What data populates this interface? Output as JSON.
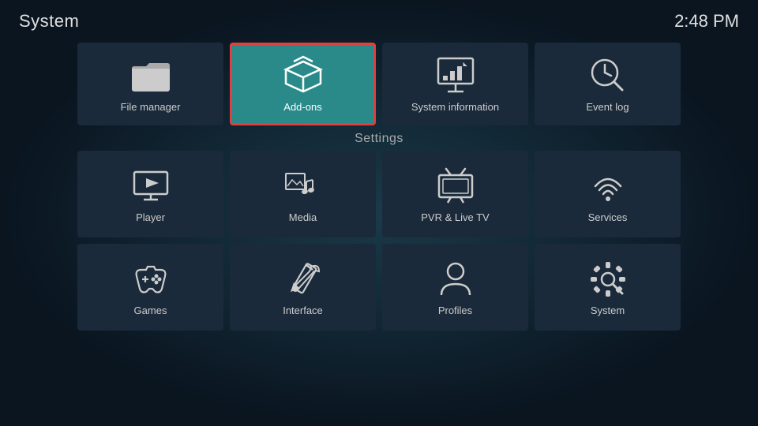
{
  "header": {
    "title": "System",
    "time": "2:48 PM"
  },
  "section_label": "Settings",
  "top_row": [
    {
      "id": "file-manager",
      "label": "File manager",
      "icon": "folder"
    },
    {
      "id": "add-ons",
      "label": "Add-ons",
      "icon": "box",
      "selected": true
    },
    {
      "id": "system-information",
      "label": "System information",
      "icon": "presentation"
    },
    {
      "id": "event-log",
      "label": "Event log",
      "icon": "clock-search"
    }
  ],
  "settings_row1": [
    {
      "id": "player",
      "label": "Player",
      "icon": "play"
    },
    {
      "id": "media",
      "label": "Media",
      "icon": "media"
    },
    {
      "id": "pvr-live-tv",
      "label": "PVR & Live TV",
      "icon": "tv"
    },
    {
      "id": "services",
      "label": "Services",
      "icon": "wifi"
    }
  ],
  "settings_row2": [
    {
      "id": "games",
      "label": "Games",
      "icon": "gamepad"
    },
    {
      "id": "interface",
      "label": "Interface",
      "icon": "pencil"
    },
    {
      "id": "profiles",
      "label": "Profiles",
      "icon": "person"
    },
    {
      "id": "system",
      "label": "System",
      "icon": "gear-fork"
    }
  ]
}
